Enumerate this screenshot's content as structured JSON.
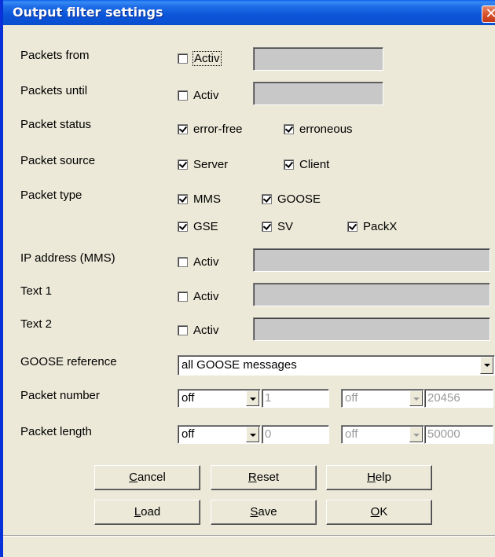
{
  "window": {
    "title": "Output filter settings",
    "close_glyph": "✕"
  },
  "rows": {
    "packets_from": {
      "label": "Packets from",
      "check_label": "Activ",
      "checked": false
    },
    "packets_until": {
      "label": "Packets until",
      "check_label": "Activ",
      "checked": false
    },
    "packet_status": {
      "label": "Packet status",
      "opt1": "error-free",
      "opt2": "erroneous"
    },
    "packet_source": {
      "label": "Packet source",
      "opt1": "Server",
      "opt2": "Client"
    },
    "packet_type": {
      "label": "Packet type",
      "opt1": "MMS",
      "opt2": "GOOSE",
      "opt3": "GSE",
      "opt4": "SV",
      "opt5": "PackX"
    },
    "ip_address": {
      "label": "IP address (MMS)",
      "check_label": "Activ"
    },
    "text1": {
      "label": "Text 1",
      "check_label": "Activ"
    },
    "text2": {
      "label": "Text 2",
      "check_label": "Activ"
    },
    "goose_reference": {
      "label": "GOOSE reference",
      "value": "all GOOSE messages"
    },
    "packet_number": {
      "label": "Packet number",
      "op1": "off",
      "val1": "1",
      "op2": "off",
      "val2": "20456"
    },
    "packet_length": {
      "label": "Packet length",
      "op1": "off",
      "val1": "0",
      "op2": "off",
      "val2": "50000"
    }
  },
  "buttons": {
    "cancel": {
      "mnemonic": "C",
      "rest": "ancel"
    },
    "reset": {
      "mnemonic": "R",
      "rest": "eset"
    },
    "help": {
      "mnemonic": "H",
      "rest": "elp"
    },
    "load": {
      "mnemonic": "L",
      "rest": "oad"
    },
    "save": {
      "mnemonic": "S",
      "rest": "ave"
    },
    "ok": {
      "mnemonic": "O",
      "rest": "K"
    }
  }
}
